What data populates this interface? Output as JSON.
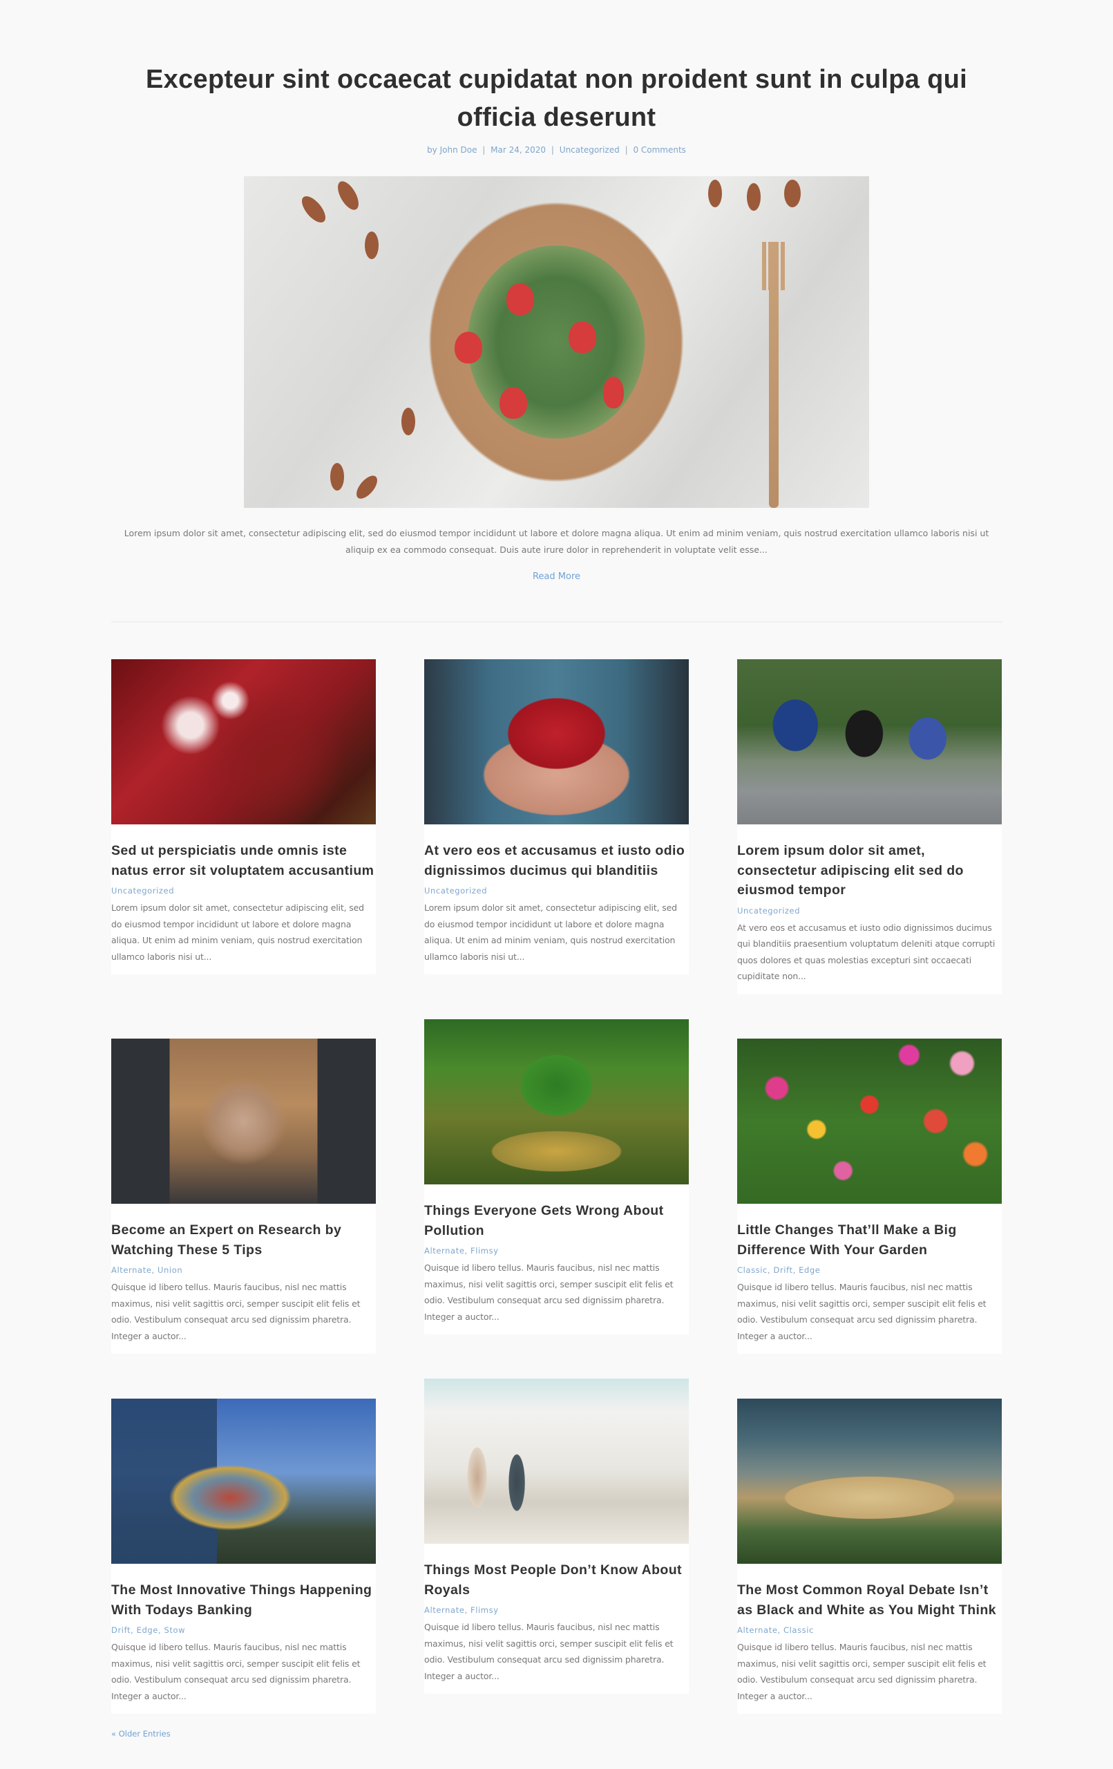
{
  "featured_post": {
    "title": "Excepteur sint occaecat cupidatat non proident sunt in culpa qui officia deserunt",
    "meta": {
      "author": "by John Doe",
      "date": "Mar 24, 2020",
      "category": "Uncategorized",
      "comments": "0 Comments",
      "separator": "|"
    },
    "image_icon": "salad-photo",
    "excerpt": "Lorem ipsum dolor sit amet, consectetur adipiscing elit, sed do eiusmod tempor incididunt ut labore et dolore magna aliqua. Ut enim ad minim veniam, quis nostrud exercitation ullamco laboris nisi ut aliquip ex ea commodo consequat. Duis aute irure dolor in reprehenderit in voluptate velit esse...",
    "read_more": "Read More"
  },
  "posts": [
    {
      "title": "Sed ut perspiciatis unde omnis iste natus error sit voluptatem accusantium",
      "categories": "Uncategorized",
      "excerpt": "Lorem ipsum dolor sit amet, consectetur adipiscing elit, sed do eiusmod tempor incididunt ut labore et dolore magna aliqua. Ut enim ad minim veniam, quis nostrud exercitation ullamco laboris nisi ut...",
      "image": "red-leaves-photo"
    },
    {
      "title": "At vero eos et accusamus et iusto odio dignissimos ducimus qui blanditiis",
      "categories": "Uncategorized",
      "excerpt": "Lorem ipsum dolor sit amet, consectetur adipiscing elit, sed do eiusmod tempor incididunt ut labore et dolore magna aliqua. Ut enim ad minim veniam, quis nostrud exercitation ullamco laboris nisi ut...",
      "image": "strawberries-in-hands-photo"
    },
    {
      "title": "Lorem ipsum dolor sit amet, consectetur adipiscing elit sed do eiusmod tempor",
      "categories": "Uncategorized",
      "excerpt": "At vero eos et accusamus et iusto odio dignissimos ducimus qui blanditiis praesentium voluptatum deleniti atque corrupti quos dolores et quas molestias excepturi sint occaecati cupiditate non...",
      "image": "cyclists-race-photo"
    },
    {
      "title": "Become an Expert on Research by Watching These 5 Tips",
      "categories": "Alternate, Union",
      "excerpt": "Quisque id libero tellus. Mauris faucibus, nisl nec mattis maximus, nisi velit sagittis orci, semper suscipit elit felis et odio. Vestibulum consequat arcu sed dignissim pharetra. Integer a auctor...",
      "image": "team-hands-photo"
    },
    {
      "title": "Things Everyone Gets Wrong About Pollution",
      "categories": "Alternate, Flimsy",
      "excerpt": "Quisque id libero tellus. Mauris faucibus, nisl nec mattis maximus, nisi velit sagittis orci, semper suscipit elit felis et odio. Vestibulum consequat arcu sed dignissim pharetra. Integer a auctor...",
      "image": "tree-in-glass-photo"
    },
    {
      "title": "Little Changes That’ll Make a Big Difference With Your Garden",
      "categories": "Classic, Drift, Edge",
      "excerpt": "Quisque id libero tellus. Mauris faucibus, nisl nec mattis maximus, nisi velit sagittis orci, semper suscipit elit felis et odio. Vestibulum consequat arcu sed dignissim pharetra. Integer a auctor...",
      "image": "wildflowers-photo"
    },
    {
      "title": "The Most Innovative Things Happening With Todays Banking",
      "categories": "Drift, Edge, Stow",
      "excerpt": "Quisque id libero tellus. Mauris faucibus, nisl nec mattis maximus, nisi velit sagittis orci, semper suscipit elit felis et odio. Vestibulum consequat arcu sed dignissim pharetra. Integer a auctor...",
      "image": "sculpture-building-photo"
    },
    {
      "title": "Things Most People Don’t Know About Royals",
      "categories": "Alternate, Flimsy",
      "excerpt": "Quisque id libero tellus. Mauris faucibus, nisl nec mattis maximus, nisi velit sagittis orci, semper suscipit elit felis et odio. Vestibulum consequat arcu sed dignissim pharetra. Integer a auctor...",
      "image": "couple-beach-photo"
    },
    {
      "title": "The Most Common Royal Debate Isn’t as Black and White as You Might Think",
      "categories": "Alternate, Classic",
      "excerpt": "Quisque id libero tellus. Mauris faucibus, nisl nec mattis maximus, nisi velit sagittis orci, semper suscipit elit felis et odio. Vestibulum consequat arcu sed dignissim pharetra. Integer a auctor...",
      "image": "palace-photo"
    }
  ],
  "pagination": {
    "older_entries": "« Older Entries"
  },
  "colors": {
    "background": "#f9f9f9",
    "card": "#ffffff",
    "accent": "#6fa2d6",
    "meta": "#7ea6cc",
    "title": "#333333",
    "body_text": "#777777"
  }
}
